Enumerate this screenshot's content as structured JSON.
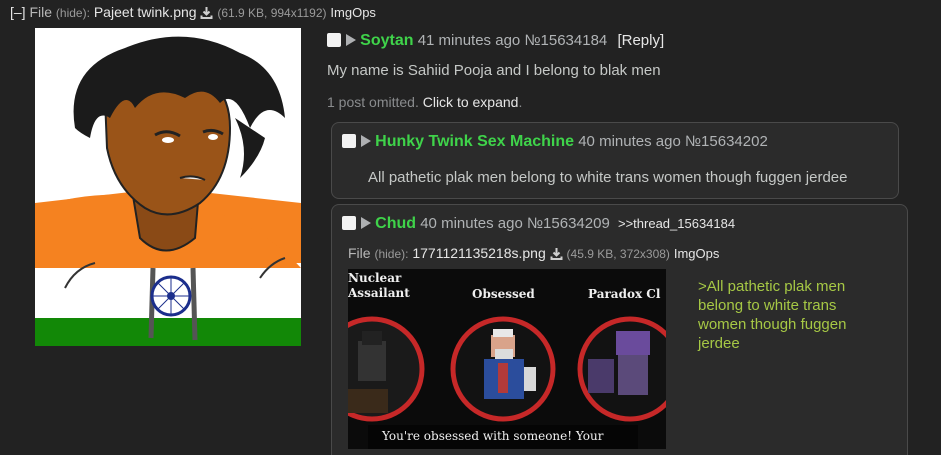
{
  "op": {
    "collapse_label": "[–]",
    "file_prefix": "File",
    "hide_label": "(hide):",
    "filename": "Pajeet twink.png",
    "filemeta": "(61.9 KB, 994x1192)",
    "imgops": "ImgOps",
    "name": "Soytan",
    "time": "41 minutes ago",
    "post_no": "№15634184",
    "reply_label": "[Reply]",
    "message": "My name is Sahiid Pooja and I belong to blak men"
  },
  "omitted": {
    "text": "1 post omitted.",
    "expand_label": "Click to expand",
    "dot": "."
  },
  "reply1": {
    "name": "Hunky Twink Sex Machine",
    "time": "40 minutes ago",
    "post_no": "№15634202",
    "message": "All pathetic plak men belong to white trans women though fuggen jerdee"
  },
  "reply2": {
    "name": "Chud",
    "time": "40 minutes ago",
    "post_no": "№15634209",
    "thread_link": ">>thread_15634184",
    "file_prefix": "File",
    "hide_label": "(hide):",
    "filename": "1771121135218s.png",
    "filemeta": "(45.9 KB, 372x308)",
    "imgops": "ImgOps",
    "greentext": ">All pathetic plak men belong to white trans women though fuggen jerdee",
    "thumb": {
      "label_left": "Nuclear Assailant",
      "label_mid": "Obsessed",
      "label_right": "Paradox Cl",
      "caption": "You're obsessed with someone! Your"
    }
  },
  "colors": {
    "background": "#222222",
    "name_green": "#3fd34a",
    "greentext": "#a6c845",
    "reply_box": "#2b2b2b"
  }
}
